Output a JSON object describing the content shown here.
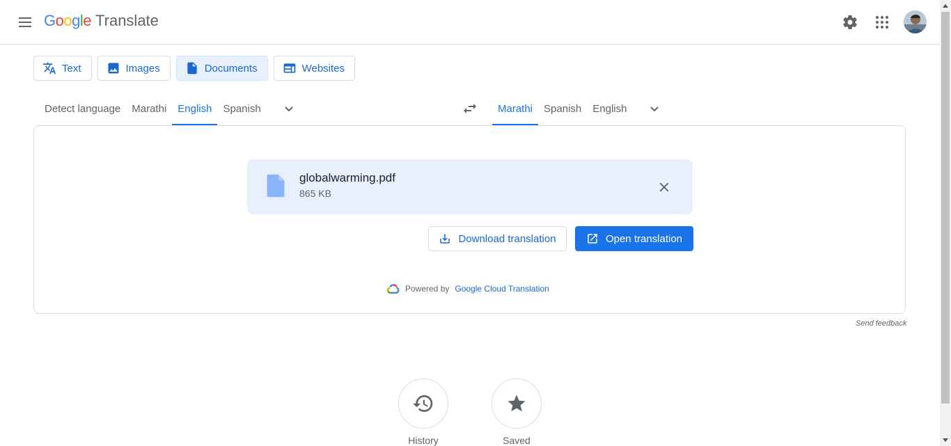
{
  "header": {
    "logo": {
      "letters": [
        "G",
        "o",
        "o",
        "g",
        "l",
        "e"
      ],
      "letter_colors": [
        "#4285f4",
        "#ea4335",
        "#fbbc05",
        "#4285f4",
        "#34a853",
        "#ea4335"
      ],
      "product": "Translate"
    },
    "icons": {
      "menu": "menu-icon",
      "settings": "settings-icon",
      "apps": "apps-grid-icon",
      "avatar": "account-avatar"
    }
  },
  "mode_tabs": [
    {
      "label": "Text",
      "icon": "translate-icon",
      "active": false
    },
    {
      "label": "Images",
      "icon": "image-icon",
      "active": false
    },
    {
      "label": "Documents",
      "icon": "document-icon",
      "active": true
    },
    {
      "label": "Websites",
      "icon": "website-icon",
      "active": false
    }
  ],
  "source_langs": [
    "Detect language",
    "Marathi",
    "English",
    "Spanish"
  ],
  "source_active": "English",
  "target_langs": [
    "Marathi",
    "Spanish",
    "English"
  ],
  "target_active": "Marathi",
  "file": {
    "name": "globalwarming.pdf",
    "size": "865 KB"
  },
  "actions": {
    "download": "Download translation",
    "open": "Open translation"
  },
  "powered": {
    "prefix": "Powered by",
    "link": "Google Cloud Translation"
  },
  "feedback": "Send feedback",
  "bottom": {
    "history": "History",
    "saved": "Saved"
  },
  "colors": {
    "accent": "#1a73e8",
    "active_tab_bg": "#e8f0fe",
    "file_bg": "#e8f0fe"
  }
}
